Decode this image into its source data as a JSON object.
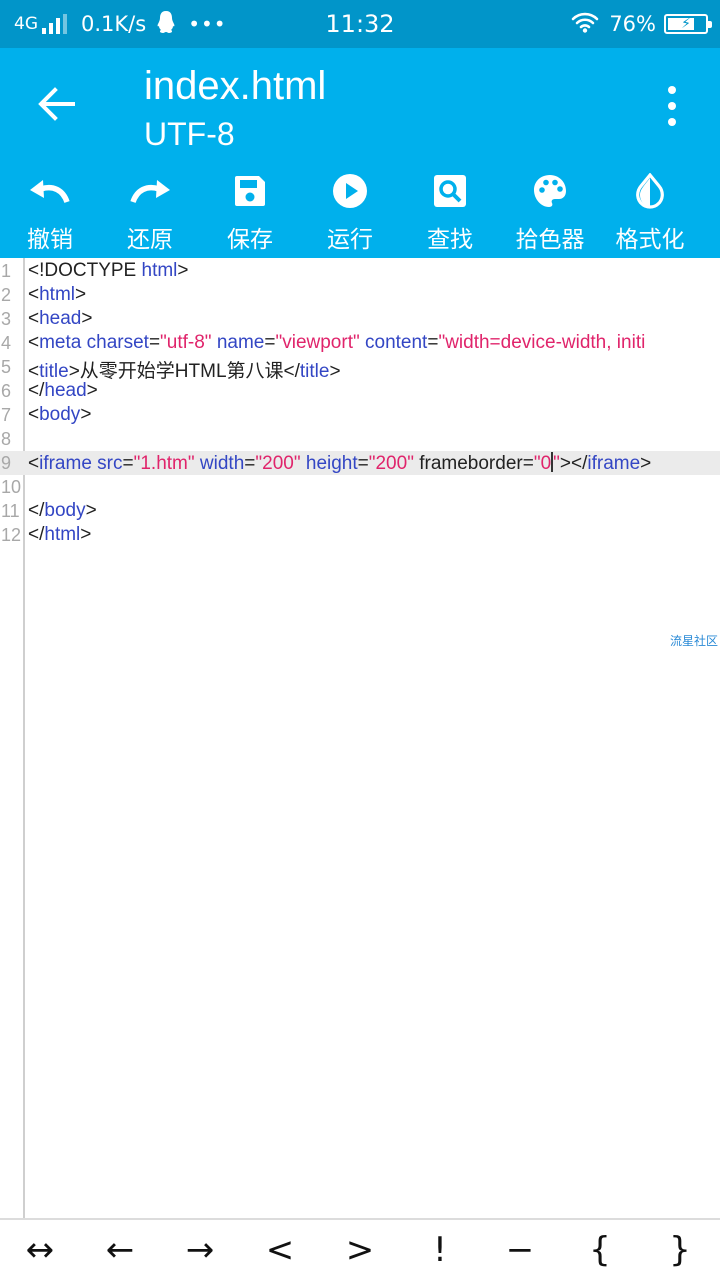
{
  "status_bar": {
    "network": "4G",
    "speed": "0.1K/s",
    "dots": "•••",
    "time": "11:32",
    "battery_percent": "76%",
    "battery_level": 0.76
  },
  "app_bar": {
    "title": "index.html",
    "subtitle": "UTF-8",
    "back_icon": "arrow-left-icon",
    "more_icon": "more-vertical-icon"
  },
  "toolbar": {
    "items": [
      {
        "label": "撤销",
        "icon": "undo-icon"
      },
      {
        "label": "还原",
        "icon": "redo-icon"
      },
      {
        "label": "保存",
        "icon": "save-icon"
      },
      {
        "label": "运行",
        "icon": "play-icon"
      },
      {
        "label": "查找",
        "icon": "search-icon"
      },
      {
        "label": "拾色器",
        "icon": "palette-icon"
      },
      {
        "label": "格式化",
        "icon": "format-drop-icon"
      }
    ]
  },
  "editor": {
    "line_numbers": [
      "1",
      "2",
      "3",
      "4",
      "5",
      "6",
      "7",
      "8",
      "9",
      "10",
      "11",
      "12"
    ],
    "current_line": 9,
    "lines": [
      {
        "t1": "<!DOCTYPE ",
        "k1": "html",
        "t2": ">"
      },
      {
        "t1": "<",
        "k1": "html",
        "t2": ">"
      },
      {
        "t1": "<",
        "k1": "head",
        "t2": ">"
      },
      {
        "t1": "<",
        "k1": "meta charset",
        "t2": "=",
        "s1": "\"utf-8\"",
        "k2": " name",
        "t3": "=",
        "s2": "\"viewport\"",
        "k3": " content",
        "t4": "=",
        "s3": "\"width=device-width, initi"
      },
      {
        "t1": "<",
        "k1": "title",
        "t2": ">从零开始学HTML第八课</",
        "k2": "title",
        "t3": ">"
      },
      {
        "t1": "</",
        "k1": "head",
        "t2": ">"
      },
      {
        "t1": "<",
        "k1": "body",
        "t2": ">"
      },
      {},
      {
        "t1": "<",
        "k1": "iframe src",
        "t2": "=",
        "s1": "\"1.htm\"",
        "k2": " width",
        "t3": "=",
        "s2": "\"200\"",
        "k3": " height",
        "t4": "=",
        "s3": "\"200\"",
        "t5": " frameborder=",
        "s4": "\"0",
        "s5": "\"",
        "t6": "></",
        "k4": "iframe",
        "t7": ">"
      },
      {},
      {
        "t1": "</",
        "k1": "body",
        "t2": ">"
      },
      {
        "t1": "</",
        "k1": "html",
        "t2": ">"
      }
    ]
  },
  "watermark": "流星社区",
  "symbol_bar": {
    "symbols": [
      "↔",
      "←",
      "→",
      "<",
      ">",
      "!",
      "−",
      "{",
      "}"
    ]
  },
  "colors": {
    "status_bar_bg": "#0195c9",
    "app_bar_bg": "#00b0ec",
    "tag_color": "#3346c4",
    "string_color": "#e0246b",
    "current_line_bg": "#ebebeb"
  }
}
